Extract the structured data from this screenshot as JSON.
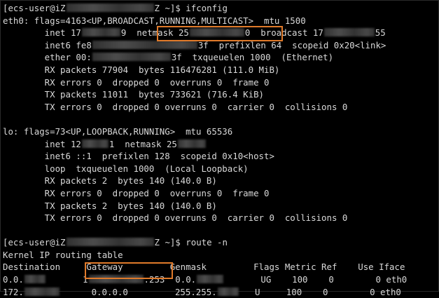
{
  "terminal": {
    "lines": [
      [
        {
          "t": "[ecs-user@iZ"
        },
        {
          "b": 125
        },
        {
          "t": "Z ~]$ ifconfig"
        }
      ],
      [
        {
          "t": "eth0: flags=4163<UP,BROADCAST,RUNNING,MULTICAST>  mtu 1500"
        }
      ],
      [
        {
          "t": "        inet 17"
        },
        {
          "b": 55
        },
        {
          "t": "9  netmask 25"
        },
        {
          "b": 78
        },
        {
          "t": "0  broadcast 17"
        },
        {
          "b": 72
        },
        {
          "t": "55"
        }
      ],
      [
        {
          "t": "        inet6 fe8"
        },
        {
          "b": 150
        },
        {
          "t": "3f  prefixlen 64  scopeid 0x20<link>"
        }
      ],
      [
        {
          "t": "        ether 00:"
        },
        {
          "b": 112
        },
        {
          "t": "3f  txqueuelen 1000  (Ethernet)"
        }
      ],
      [
        {
          "t": "        RX packets 77904  bytes 116476281 (111.0 MiB)"
        }
      ],
      [
        {
          "t": "        RX errors 0  dropped 0  overruns 0  frame 0"
        }
      ],
      [
        {
          "t": "        TX packets 11011  bytes 733621 (716.4 KiB)"
        }
      ],
      [
        {
          "t": "        TX errors 0  dropped 0 overruns 0  carrier 0  collisions 0"
        }
      ],
      [
        {
          "t": ""
        }
      ],
      [
        {
          "t": "lo: flags=73<UP,LOOPBACK,RUNNING>  mtu 65536"
        }
      ],
      [
        {
          "t": "        inet 12"
        },
        {
          "b": 38
        },
        {
          "t": "1  netmask 25"
        },
        {
          "b": 40
        }
      ],
      [
        {
          "t": "        inet6 ::1  prefixlen 128  scopeid 0x10<host>"
        }
      ],
      [
        {
          "t": "        loop  txqueuelen 1000  (Local Loopback)"
        }
      ],
      [
        {
          "t": "        RX packets 2  bytes 140 (140.0 B)"
        }
      ],
      [
        {
          "t": "        RX errors 0  dropped 0  overruns 0  frame 0"
        }
      ],
      [
        {
          "t": "        TX packets 2  bytes 140 (140.0 B)"
        }
      ],
      [
        {
          "t": "        TX errors 0  dropped 0 overruns 0  carrier 0  collisions 0"
        }
      ],
      [
        {
          "t": ""
        }
      ],
      [
        {
          "t": "[ecs-user@iZ"
        },
        {
          "b": 125
        },
        {
          "t": "Z ~]$ route -n"
        }
      ],
      [
        {
          "t": "Kernel IP routing table"
        }
      ],
      [
        {
          "t": "Destination     Gateway         Genmask         Flags Metric Ref    Use Iface"
        }
      ],
      [
        {
          "t": "0.0."
        },
        {
          "b": 30
        },
        {
          "t": "       1"
        },
        {
          "b": 78
        },
        {
          "t": ".253  0.0."
        },
        {
          "b": 38
        },
        {
          "t": "       UG    100    0        0 eth0"
        }
      ],
      [
        {
          "t": "172."
        },
        {
          "b": 50
        },
        {
          "t": "      0.0.0.0         255.255."
        },
        {
          "b": 30
        },
        {
          "t": "   U     100    0        0 eth0"
        }
      ]
    ]
  },
  "highlights": [
    "netmask-highlight",
    "gateway-highlight"
  ]
}
